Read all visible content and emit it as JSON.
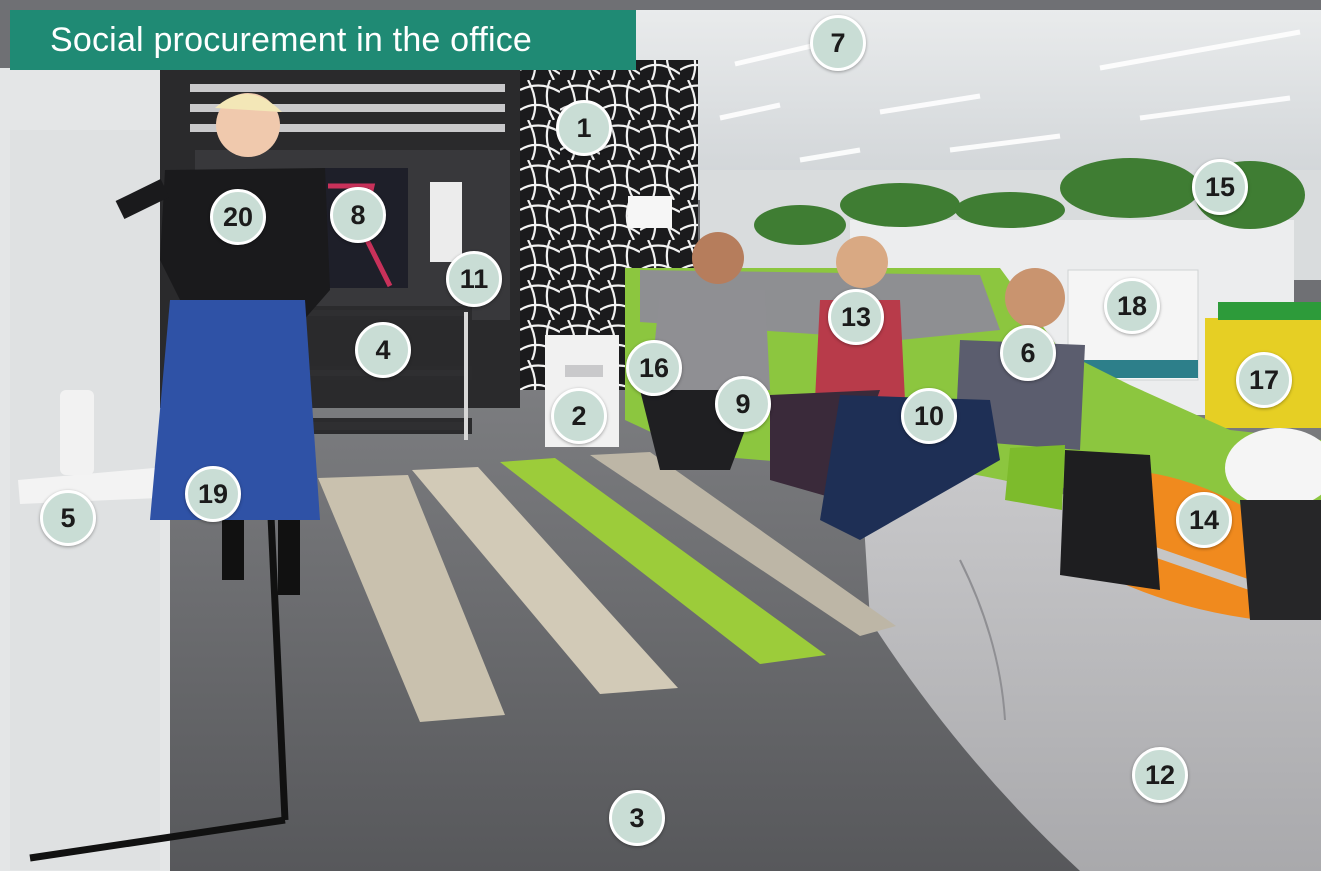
{
  "title": "Social procurement in the office",
  "colors": {
    "banner": "#1f8a74",
    "marker_fill": "#c9ddd5",
    "marker_text": "#1b1b1b",
    "couch_green": "#8cc63f",
    "carpet": "#6f7074"
  },
  "markers": [
    {
      "id": "m1",
      "label": "1"
    },
    {
      "id": "m2",
      "label": "2"
    },
    {
      "id": "m3",
      "label": "3"
    },
    {
      "id": "m4",
      "label": "4"
    },
    {
      "id": "m5",
      "label": "5"
    },
    {
      "id": "m6",
      "label": "6"
    },
    {
      "id": "m7",
      "label": "7"
    },
    {
      "id": "m8",
      "label": "8"
    },
    {
      "id": "m9",
      "label": "9"
    },
    {
      "id": "m10",
      "label": "10"
    },
    {
      "id": "m11",
      "label": "11"
    },
    {
      "id": "m12",
      "label": "12"
    },
    {
      "id": "m13",
      "label": "13"
    },
    {
      "id": "m14",
      "label": "14"
    },
    {
      "id": "m15",
      "label": "15"
    },
    {
      "id": "m16",
      "label": "16"
    },
    {
      "id": "m17",
      "label": "17"
    },
    {
      "id": "m18",
      "label": "18"
    },
    {
      "id": "m19",
      "label": "19"
    },
    {
      "id": "m20",
      "label": "20"
    }
  ]
}
